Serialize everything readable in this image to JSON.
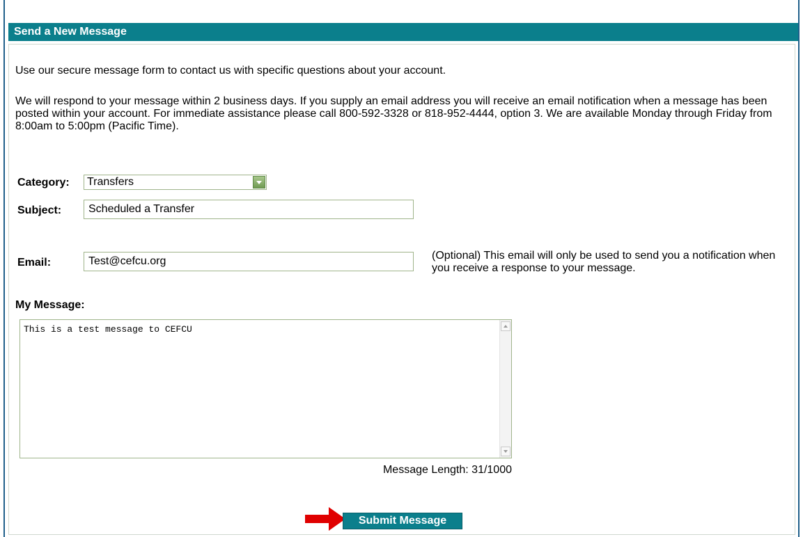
{
  "header": {
    "title": "Send a New Message"
  },
  "intro": {
    "line1": "Use our secure message form to contact us with specific questions about your account.",
    "line2": "We will respond to your message within 2 business days. If you supply an email address you will receive an email notification when a message has been posted within your account. For immediate assistance please call 800-592-3328 or 818-952-4444, option 3. We are available Monday through Friday from 8:00am to 5:00pm (Pacific Time)."
  },
  "form": {
    "category_label": "Category:",
    "category_value": "Transfers",
    "subject_label": "Subject:",
    "subject_value": "Scheduled a Transfer",
    "email_label": "Email:",
    "email_value": "Test@cefcu.org",
    "email_note": "(Optional) This email will only be used to send you a notification when you receive a response to your message.",
    "message_label": "My Message:",
    "message_value": "This is a test message to CEFCU",
    "message_length": "Message Length: 31/1000",
    "submit_label": "Submit Message"
  },
  "icons": {
    "dropdown": "chevron-down-icon",
    "pointer": "arrow-right-icon"
  },
  "colors": {
    "header_bg": "#0b7f8c",
    "button_bg": "#0b7f8c",
    "arrow": "#e00000"
  }
}
